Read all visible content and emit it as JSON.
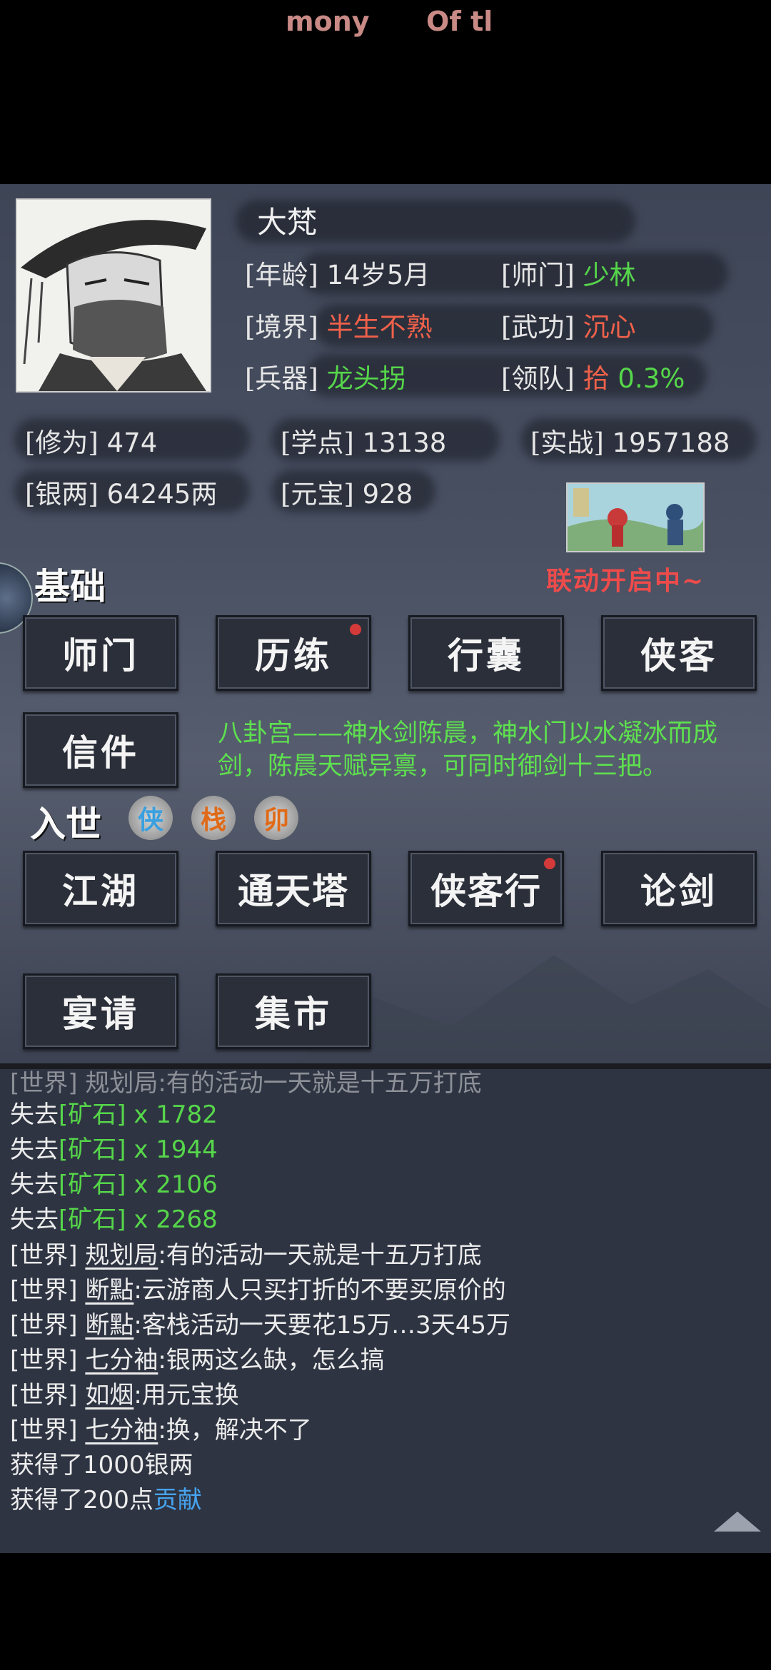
{
  "top_bar": {
    "text1": "mony",
    "text2": "Of tl"
  },
  "profile": {
    "name": "大梵",
    "age_label": "[年龄]",
    "age_value": "14岁5月",
    "sect_label": "[师门]",
    "sect_value": "少林",
    "realm_label": "[境界]",
    "realm_value": "半生不熟",
    "skill_label": "[武功]",
    "skill_value": "沉心",
    "weapon_label": "[兵器]",
    "weapon_value": "龙头拐",
    "lead_label": "[领队]",
    "lead_value": "拾",
    "lead_percent": "0.3%",
    "cult_label": "[修为]",
    "cult_value": "474",
    "study_label": "[学点]",
    "study_value": "13138",
    "combat_label": "[实战]",
    "combat_value": "1957188",
    "silver_label": "[银两]",
    "silver_value": "64245两",
    "ingot_label": "[元宝]",
    "ingot_value": "928"
  },
  "event": {
    "linkup_text": "联动开启中~"
  },
  "basic_section": {
    "title": "基础",
    "buttons": [
      "师门",
      "历练",
      "行囊",
      "侠客",
      "信件"
    ]
  },
  "story_text": "八卦宫——神水剑陈晨，神水门以水凝冰而成剑，陈晨天赋异禀，可同时御剑十三把。",
  "world_section": {
    "title": "入世",
    "seals": [
      {
        "char": "侠",
        "color": "#3aa0e0"
      },
      {
        "char": "栈",
        "color": "#e06a18"
      },
      {
        "char": "卯",
        "color": "#e06a18"
      }
    ],
    "buttons": [
      "江湖",
      "通天塔",
      "侠客行",
      "论剑",
      "宴请",
      "集市"
    ]
  },
  "log": {
    "lines": [
      {
        "prefix": "失去",
        "item": "[矿石]",
        "qty": " x 1782"
      },
      {
        "prefix": "失去",
        "item": "[矿石]",
        "qty": " x 1944"
      },
      {
        "prefix": "失去",
        "item": "[矿石]",
        "qty": " x 2106"
      },
      {
        "prefix": "失去",
        "item": "[矿石]",
        "qty": " x 2268"
      }
    ],
    "chat": [
      {
        "channel": "[世界]",
        "user": "规划局",
        "msg": ":有的活动一天就是十五万打底"
      },
      {
        "channel": "[世界]",
        "user": "断點",
        "msg": ":云游商人只买打折的不要买原价的"
      },
      {
        "channel": "[世界]",
        "user": "断點",
        "msg": ":客栈活动一天要花15万…3天45万"
      },
      {
        "channel": "[世界]",
        "user": "七分袖",
        "msg": ":银两这么缺，怎么搞"
      },
      {
        "channel": "[世界]",
        "user": "如烟",
        "msg": ":用元宝换"
      },
      {
        "channel": "[世界]",
        "user": "七分袖",
        "msg": ":换，解决不了"
      }
    ],
    "gain_silver": "获得了1000银两",
    "gain_contrib_prefix": "获得了200点",
    "gain_contrib_word": "贡献"
  },
  "colors": {
    "green": "#56d64a",
    "red": "#f0614a",
    "blue": "#46a4f0"
  }
}
